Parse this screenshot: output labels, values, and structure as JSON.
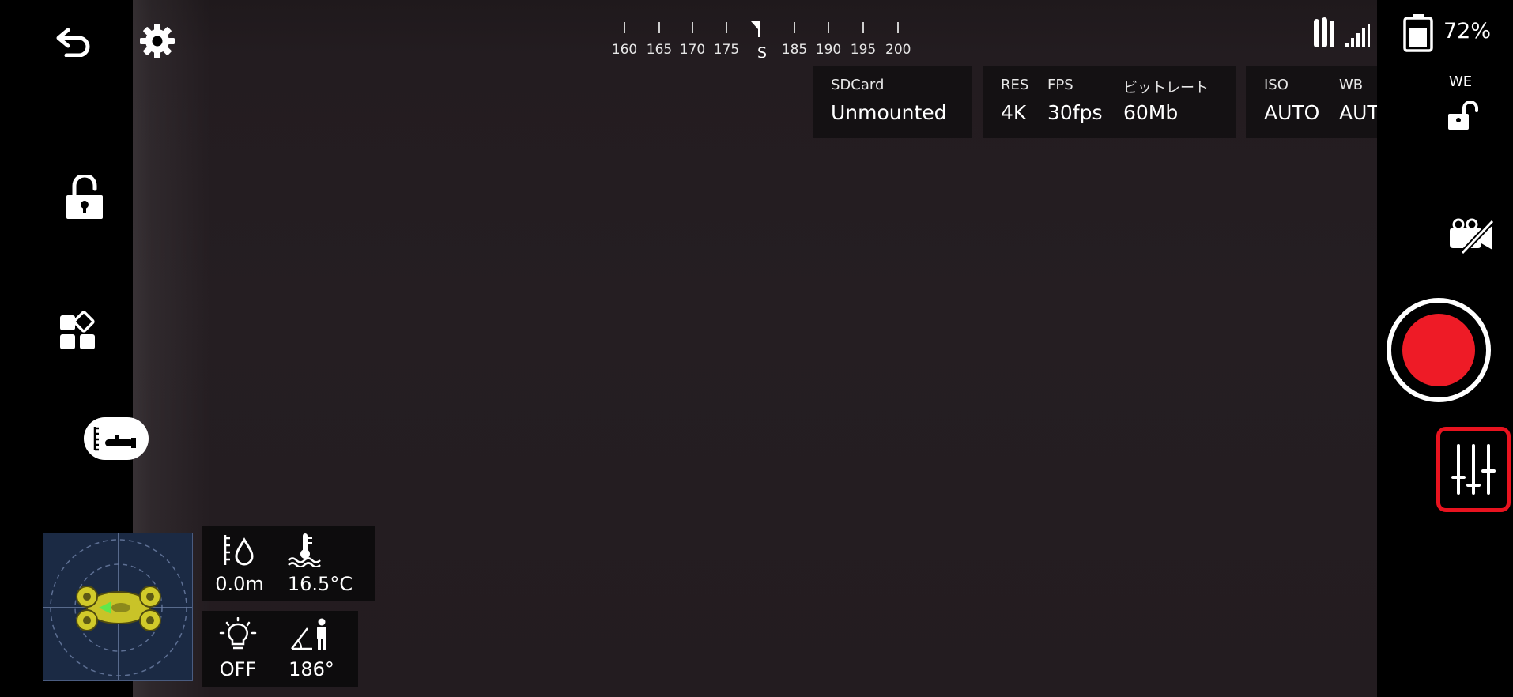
{
  "compass": {
    "ticks": [
      "160",
      "165",
      "170",
      "175",
      "S",
      "185",
      "190",
      "195",
      "200"
    ],
    "heading_marker": "S"
  },
  "status": {
    "battery_percent": "72%"
  },
  "storage": {
    "label": "SDCard",
    "value": "Unmounted"
  },
  "video": {
    "res_label": "RES",
    "res_value": "4K",
    "fps_label": "FPS",
    "fps_value": "30fps",
    "bitrate_label": "ビットレート",
    "bitrate_value": "60Mb"
  },
  "camera": {
    "iso_label": "ISO",
    "iso_value": "AUTO",
    "wb_label": "WB",
    "wb_value": "AUTO"
  },
  "right_panel": {
    "we_label": "WE"
  },
  "telemetry": {
    "depth": "0.0m",
    "temperature": "16.5°C",
    "light": "OFF",
    "tilt": "186°"
  },
  "colors": {
    "record": "#ee1b26",
    "highlight_frame": "#e8131f",
    "drone_body": "#c9c328",
    "minimap_bg": "#1b2a44"
  },
  "icons": [
    "back-arrow-icon",
    "gear-icon",
    "unlock-icon",
    "apps-icon",
    "depth-gauge-icon",
    "signal-icon",
    "battery-icon",
    "lock-icon",
    "camera-off-icon",
    "record-icon",
    "sliders-icon",
    "depth-icon",
    "water-temperature-icon",
    "light-icon",
    "tilt-icon"
  ]
}
